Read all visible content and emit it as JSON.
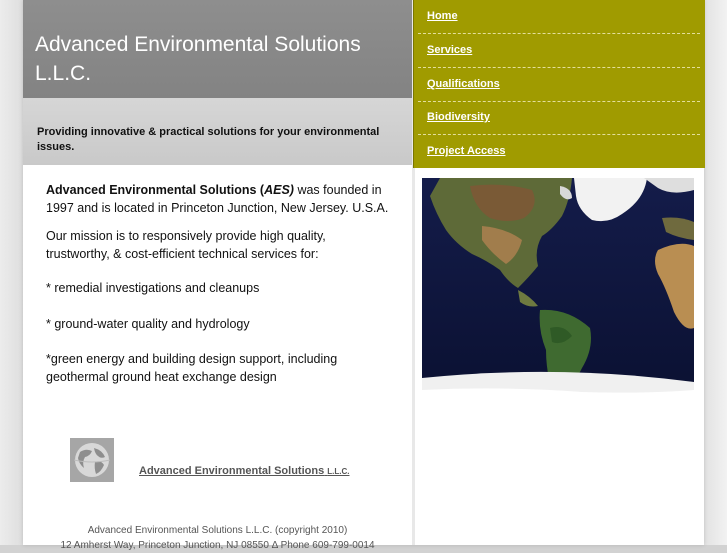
{
  "header": {
    "title": "Advanced Environmental Solutions L.L.C.",
    "tagline": "Providing innovative & practical solutions for your environmental issues."
  },
  "nav": {
    "items": [
      {
        "label": "Home"
      },
      {
        "label": "Services"
      },
      {
        "label": "Qualifications"
      },
      {
        "label": "Biodiversity"
      },
      {
        "label": "Project Access"
      }
    ]
  },
  "main": {
    "intro_company": "Advanced Environmental Solutions (",
    "intro_abbrev": "AES)",
    "intro_rest": " was founded in 1997 and is located in Princeton Junction, New Jersey. U.S.A.",
    "mission": "Our mission is to responsively provide high quality, trustworthy, & cost-efficient technical services for:",
    "services": [
      "* remedial investigations and cleanups",
      "* ground-water quality and hydrology",
      "*green energy and building design support, including geothermal ground heat exchange design"
    ]
  },
  "footer": {
    "link_main": "Advanced Environmental Solutions",
    "link_suffix": "L.L.C.",
    "copyright": "Advanced Environmental Solutions L.L.C. (copyright 2010)",
    "address": "12 Amherst Way, Princeton Junction, NJ 08550  Δ  Phone 609-799-0014"
  },
  "images": {
    "hero": "world-map-satellite",
    "logo": "globe-icon"
  },
  "colors": {
    "nav_background": "#a09b00",
    "header_background": "#8a8a8a",
    "tagline_background": "#d0d0d0"
  }
}
